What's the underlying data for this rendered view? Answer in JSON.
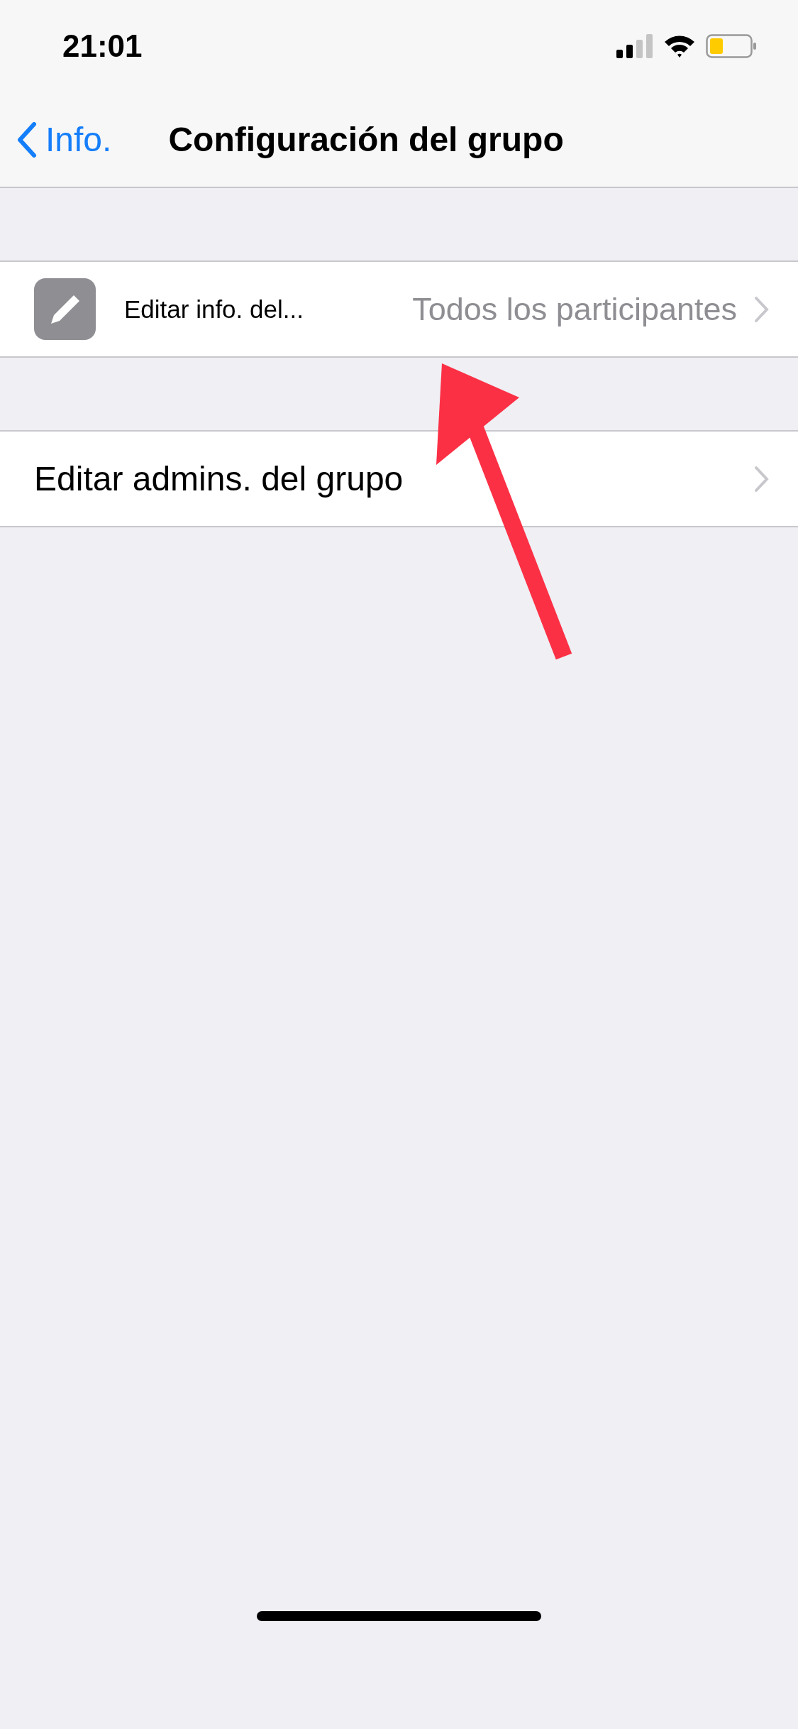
{
  "status_bar": {
    "time": "21:01"
  },
  "nav": {
    "back": "Info.",
    "title": "Configuración del grupo"
  },
  "sections": [
    {
      "rows": [
        {
          "kind": "icon",
          "label": "Editar info. del...",
          "value": "Todos los participantes"
        }
      ]
    },
    {
      "rows": [
        {
          "kind": "plain",
          "label": "Editar admins. del grupo"
        }
      ]
    }
  ],
  "annotations": [
    {
      "kind": "arrow"
    }
  ]
}
